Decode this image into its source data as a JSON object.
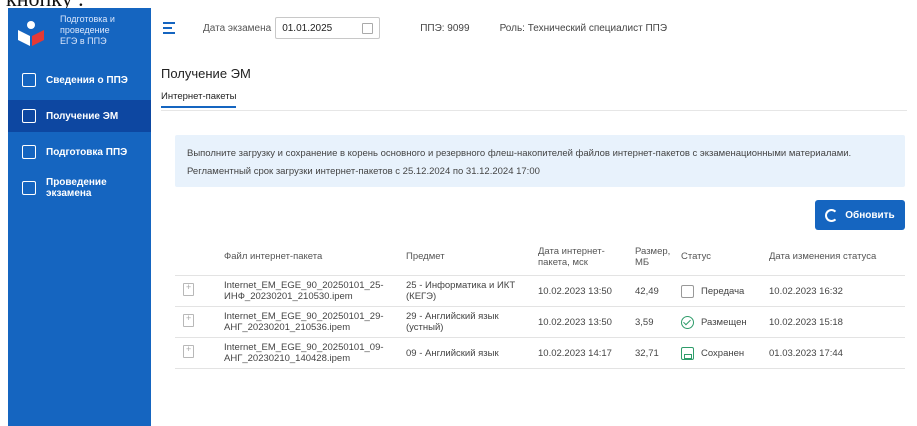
{
  "top_clip_text": "кнопку .",
  "sidebar": {
    "logo_text": [
      "Подготовка и",
      "проведение",
      "ЕГЭ в ППЭ"
    ],
    "items": [
      {
        "label": "Сведения о ППЭ",
        "active": false
      },
      {
        "label": "Получение ЭМ",
        "active": true
      },
      {
        "label": "Подготовка ППЭ",
        "active": false
      },
      {
        "label": "Проведение экзамена",
        "active": false
      }
    ]
  },
  "header": {
    "date_label": "Дата экзамена",
    "date_value": "01.01.2025",
    "ppe": "ППЭ: 9099",
    "role": "Роль: Технический специалист ППЭ"
  },
  "main": {
    "title": "Получение ЭМ",
    "tab": "Интернет-пакеты",
    "info_line1": "Выполните загрузку и сохранение в корень основного и резервного флеш-накопителей файлов интернет-пакетов с экзаменационными материалами.",
    "info_line2": "Регламентный срок загрузки интернет-пакетов с 25.12.2024 по 31.12.2024 17:00",
    "refresh_label": "Обновить"
  },
  "table": {
    "headers": [
      "Файл интернет-пакета",
      "Предмет",
      "Дата интернет-пакета, мск",
      "Размер, МБ",
      "Статус",
      "Дата изменения статуса"
    ],
    "rows": [
      {
        "file": "Internet_EM_EGE_90_20250101_25-ИНФ_20230201_210530.ipem",
        "subject": "25 - Информатика и ИКТ (КЕГЭ)",
        "date": "10.02.2023 13:50",
        "size": "42,49",
        "status": "Передача",
        "status_type": "send",
        "changed": "10.02.2023 16:32"
      },
      {
        "file": "Internet_EM_EGE_90_20250101_29-АНГ_20230201_210536.ipem",
        "subject": "29 - Английский язык (устный)",
        "date": "10.02.2023 13:50",
        "size": "3,59",
        "status": "Размещен",
        "status_type": "placed",
        "changed": "10.02.2023 15:18"
      },
      {
        "file": "Internet_EM_EGE_90_20250101_09-АНГ_20230210_140428.ipem",
        "subject": "09 - Английский язык",
        "date": "10.02.2023 14:17",
        "size": "32,71",
        "status": "Сохранен",
        "status_type": "saved",
        "changed": "01.03.2023 17:44"
      }
    ]
  },
  "colors": {
    "primary": "#1565c0",
    "sidebar_active": "#0d47a1",
    "info_bg": "#e8f2fc",
    "status_ok": "#2e9c6a"
  }
}
